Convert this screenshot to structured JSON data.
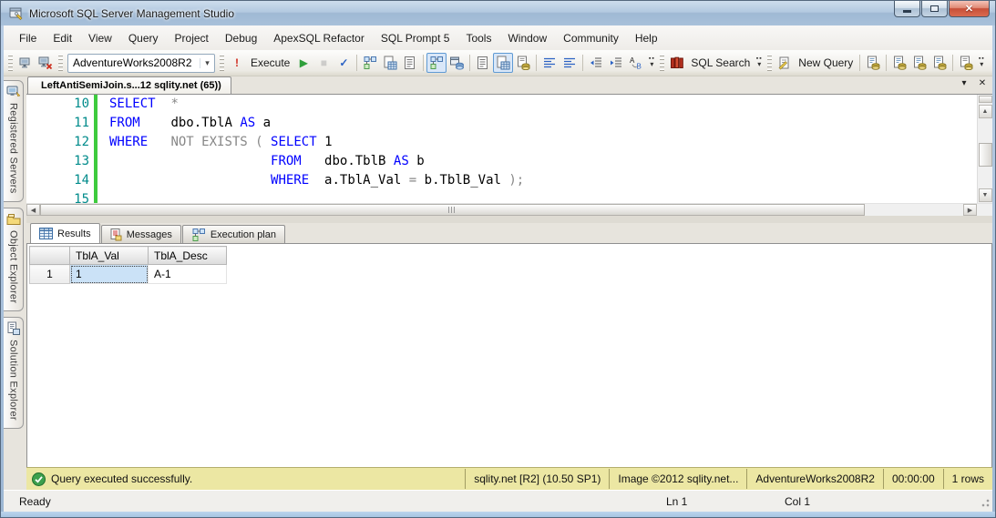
{
  "window": {
    "title": "Microsoft SQL Server Management Studio"
  },
  "menu": {
    "items": [
      "File",
      "Edit",
      "View",
      "Query",
      "Project",
      "Debug",
      "ApexSQL Refactor",
      "SQL Prompt 5",
      "Tools",
      "Window",
      "Community",
      "Help"
    ]
  },
  "icons": {
    "chevron_down": "▾",
    "close": "✕",
    "minimize": "",
    "maximize": "",
    "scroll_up": "▲",
    "scroll_down": "▼",
    "scroll_left": "◀",
    "scroll_right": "▶",
    "execute_hint": "!",
    "play": "▶",
    "stop": "■",
    "parse": "✓",
    "overflow": "▾"
  },
  "colors": {
    "keyword_blue": "#0000ff",
    "operator_gray": "#878787",
    "line_number_teal": "#008b8b",
    "status_yellow": "#ece7a3",
    "success_green": "#3da04c",
    "close_red": "#c6402c",
    "selected_cell_blue": "#cbe2f7",
    "toggle_highlight": "#d9e7f8"
  },
  "toolbar": {
    "groups": [
      {
        "name": "connection-group",
        "items": [
          {
            "name": "connect-icon",
            "icon": "computer"
          },
          {
            "name": "change-connection-icon",
            "icon": "computerx"
          }
        ]
      },
      {
        "name": "database-group",
        "combo": "AdventureWorks2008R2"
      },
      {
        "name": "execute-group",
        "items": [
          {
            "name": "execute-hint-icon",
            "glyph": "!",
            "color": "#cf2b1f",
            "bold": true
          },
          {
            "name": "execute-button",
            "label": "Execute"
          },
          {
            "name": "debug-play-icon",
            "glyph": "▶",
            "color": "#2f9f3b"
          },
          {
            "name": "stop-icon",
            "glyph": "■",
            "color": "#a9a9a9",
            "disabled": true
          },
          {
            "name": "parse-icon",
            "glyph": "✓",
            "color": "#2b62c4",
            "bold": true
          },
          {
            "sep": true
          },
          {
            "name": "estimated-plan-icon",
            "icon": "plan"
          },
          {
            "name": "query-options-icon",
            "icon": "docgrid"
          },
          {
            "name": "design-query-icon",
            "icon": "doctext"
          },
          {
            "sep": true
          },
          {
            "name": "actual-plan-toggle",
            "icon": "plan",
            "toggled": true
          },
          {
            "name": "client-statistics-icon",
            "icon": "dbwin"
          },
          {
            "sep": true
          },
          {
            "name": "results-to-text-icon",
            "icon": "doctext"
          },
          {
            "name": "results-to-grid-toggle",
            "icon": "docgrid",
            "toggled": true
          },
          {
            "name": "results-to-file-icon",
            "icon": "docsave"
          },
          {
            "sep": true
          },
          {
            "name": "comment-icon",
            "icon": "lines"
          },
          {
            "name": "uncomment-icon",
            "icon": "lines"
          },
          {
            "sep": true
          },
          {
            "name": "decrease-indent-icon",
            "icon": "outdent"
          },
          {
            "name": "increase-indent-icon",
            "icon": "indent"
          },
          {
            "name": "template-params-icon",
            "icon": "ab"
          },
          {
            "name": "toolbar-overflow",
            "overflow": true
          }
        ]
      },
      {
        "name": "sql-search-group",
        "items": [
          {
            "name": "sql-search-icon",
            "icon": "search"
          },
          {
            "name": "sql-search-button",
            "label": "SQL Search"
          },
          {
            "name": "toolbar-overflow",
            "overflow": true
          }
        ]
      },
      {
        "name": "new-query-group",
        "items": [
          {
            "name": "new-query-icon",
            "icon": "newquery"
          },
          {
            "name": "new-query-button",
            "label": "New Query"
          },
          {
            "sep": true
          },
          {
            "name": "database-engine-query-icon",
            "icon": "docdb"
          },
          {
            "sep": true
          },
          {
            "name": "mdx-query-icon",
            "icon": "docdb"
          },
          {
            "name": "dmx-query-icon",
            "icon": "docdb"
          },
          {
            "name": "xmla-query-icon",
            "icon": "docdb"
          },
          {
            "sep": true
          },
          {
            "name": "analysis-script-icon",
            "icon": "docsave"
          },
          {
            "name": "toolbar-overflow",
            "overflow": true
          }
        ]
      }
    ]
  },
  "sidebar": {
    "tabs": [
      {
        "label": "Registered Servers",
        "icon": "servers"
      },
      {
        "label": "Object Explorer",
        "icon": "objectexp"
      },
      {
        "label": "Solution Explorer",
        "icon": "solution"
      }
    ]
  },
  "editor": {
    "tab_title": "LeftAntiSemiJoin.s...12 sqlity.net (65))",
    "lines": [
      {
        "num": "10",
        "tokens": [
          [
            "kw",
            "SELECT"
          ],
          [
            "ws",
            "  "
          ],
          [
            "gr",
            "*"
          ]
        ]
      },
      {
        "num": "11",
        "tokens": [
          [
            "kw",
            "FROM"
          ],
          [
            "ws",
            "    "
          ],
          [
            "id",
            "dbo.TblA"
          ],
          [
            "ws",
            " "
          ],
          [
            "kw",
            "AS"
          ],
          [
            "ws",
            " "
          ],
          [
            "id",
            "a"
          ]
        ]
      },
      {
        "num": "12",
        "tokens": [
          [
            "kw",
            "WHERE"
          ],
          [
            "ws",
            "   "
          ],
          [
            "gr",
            "NOT EXISTS ("
          ],
          [
            "ws",
            " "
          ],
          [
            "kw",
            "SELECT"
          ],
          [
            "ws",
            " "
          ],
          [
            "id",
            "1"
          ]
        ]
      },
      {
        "num": "13",
        "tokens": [
          [
            "ws",
            "                     "
          ],
          [
            "kw",
            "FROM"
          ],
          [
            "ws",
            "   "
          ],
          [
            "id",
            "dbo.TblB"
          ],
          [
            "ws",
            " "
          ],
          [
            "kw",
            "AS"
          ],
          [
            "ws",
            " "
          ],
          [
            "id",
            "b"
          ]
        ]
      },
      {
        "num": "14",
        "tokens": [
          [
            "ws",
            "                     "
          ],
          [
            "kw",
            "WHERE"
          ],
          [
            "ws",
            "  "
          ],
          [
            "id",
            "a.TblA_Val"
          ],
          [
            "ws",
            " "
          ],
          [
            "gr",
            "="
          ],
          [
            "ws",
            " "
          ],
          [
            "id",
            "b.TblB_Val"
          ],
          [
            "ws",
            " "
          ],
          [
            "gr",
            ");"
          ]
        ]
      },
      {
        "num": "15",
        "tokens": []
      }
    ]
  },
  "results": {
    "tabs": [
      {
        "label": "Results",
        "icon": "gridtab",
        "active": true
      },
      {
        "label": "Messages",
        "icon": "msgtab",
        "active": false
      },
      {
        "label": "Execution plan",
        "icon": "plan",
        "active": false
      }
    ],
    "grid": {
      "columns": [
        "TblA_Val",
        "TblA_Desc"
      ],
      "rows": [
        {
          "n": "1",
          "cells": [
            "1",
            "A-1"
          ],
          "selected_cell": 0
        }
      ]
    }
  },
  "query_status": {
    "message": "Query executed successfully.",
    "segments": [
      "sqlity.net [R2] (10.50 SP1)",
      "Image ©2012 sqlity.net...",
      "AdventureWorks2008R2",
      "00:00:00",
      "1 rows"
    ]
  },
  "statusbar": {
    "state": "Ready",
    "line": "Ln 1",
    "col": "Col 1"
  }
}
